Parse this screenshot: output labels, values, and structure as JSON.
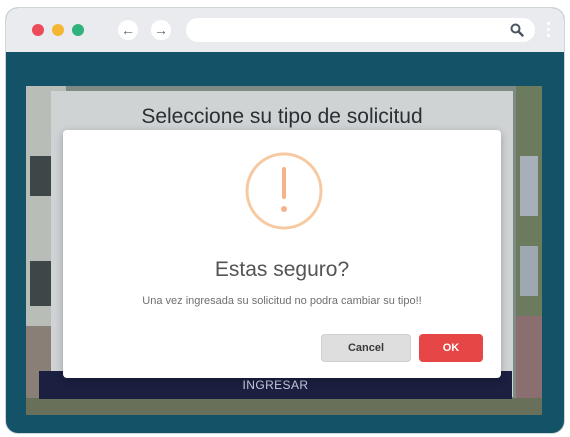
{
  "browser": {
    "traffic_lights": [
      "close",
      "minimize",
      "maximize"
    ],
    "icons": {
      "back": "←",
      "forward": "→",
      "search": "search-icon"
    },
    "url": ""
  },
  "colors": {
    "frame": "#135267",
    "chrome": "#e9ebee",
    "ok_button": "#e64646",
    "warning": "#f6b38a",
    "ingresar": "#1b1f40"
  },
  "form": {
    "title": "Seleccione su tipo de solicitud",
    "submit_label": "INGRESAR"
  },
  "dialog": {
    "icon": "warning-icon",
    "title": "Estas seguro?",
    "message": "Una vez ingresada su solicitud no podra cambiar su tipo!!",
    "cancel_label": "Cancel",
    "ok_label": "OK"
  }
}
